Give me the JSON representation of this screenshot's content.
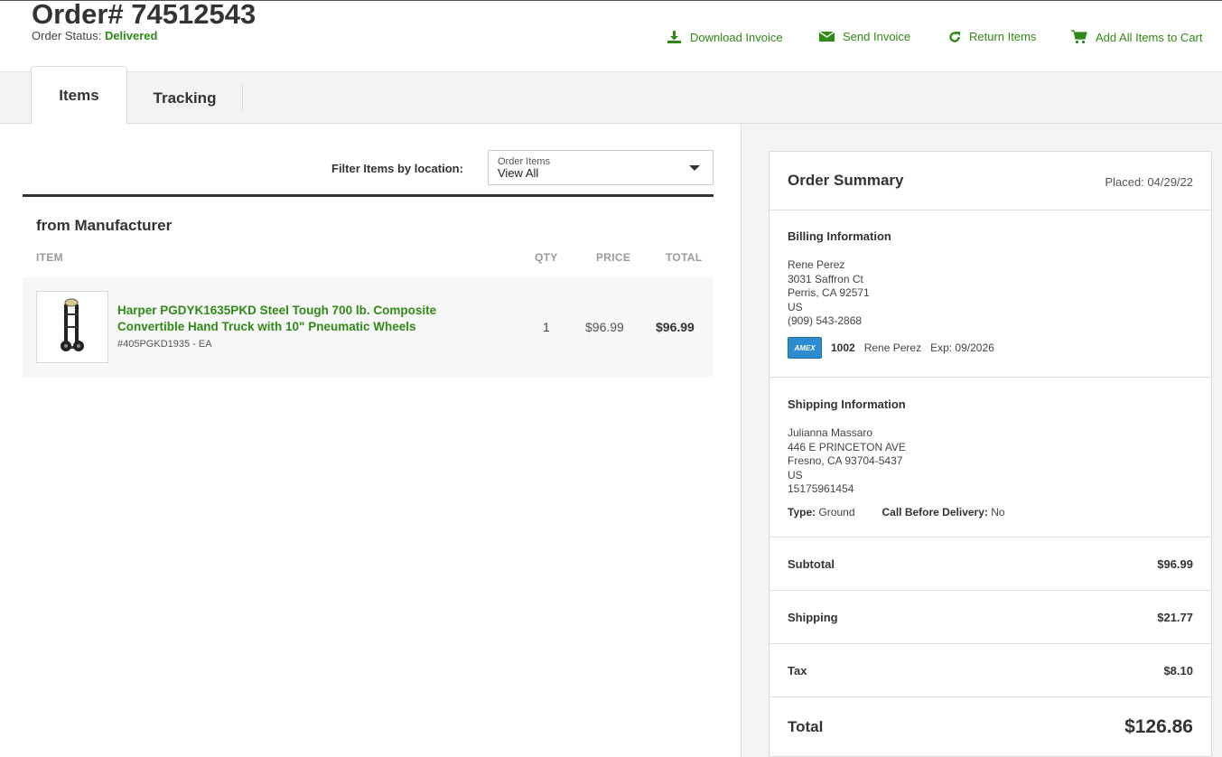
{
  "header": {
    "order_title": "Order# 74512543",
    "status_label": "Order Status:",
    "status_value": "Delivered"
  },
  "actions": {
    "download": "Download Invoice",
    "send": "Send Invoice",
    "return": "Return Items",
    "add_cart": "Add All Items to Cart"
  },
  "tabs": {
    "items": "Items",
    "tracking": "Tracking"
  },
  "filter": {
    "label": "Filter Items by location:",
    "select_caption": "Order Items",
    "select_value": "View All"
  },
  "items_section": {
    "title": "from Manufacturer",
    "columns": {
      "item": "ITEM",
      "qty": "QTY",
      "price": "PRICE",
      "total": "TOTAL"
    },
    "rows": [
      {
        "name": "Harper PGDYK1635PKD Steel Tough 700 lb. Composite Convertible Hand Truck with 10\" Pneumatic Wheels",
        "sku": "#405PGKD1935 - EA",
        "qty": "1",
        "price": "$96.99",
        "total": "$96.99"
      }
    ]
  },
  "summary": {
    "title": "Order Summary",
    "placed": "Placed: 04/29/22",
    "billing": {
      "title": "Billing Information",
      "name": "Rene Perez",
      "street": "3031 Saffron Ct",
      "city": "Perris, CA 92571",
      "country": "US",
      "phone": "(909) 543-2868",
      "card_brand": "AMEX",
      "card_last4": "1002",
      "card_holder": "Rene Perez",
      "card_exp": "Exp: 09/2026"
    },
    "shipping": {
      "title": "Shipping Information",
      "name": "Julianna Massaro",
      "street": "446 E PRINCETON AVE",
      "city": "Fresno, CA 93704-5437",
      "country": "US",
      "phone": "15175961454",
      "type_label": "Type:",
      "type_value": "Ground",
      "call_label": "Call Before Delivery:",
      "call_value": "No"
    },
    "subtotal_label": "Subtotal",
    "subtotal_value": "$96.99",
    "shipping_label": "Shipping",
    "shipping_value": "$21.77",
    "tax_label": "Tax",
    "tax_value": "$8.10",
    "total_label": "Total",
    "total_value": "$126.86"
  },
  "colors": {
    "accent_green": "#2f8a16",
    "text_dark": "#333333",
    "amex_blue": "#2c8ccf"
  }
}
